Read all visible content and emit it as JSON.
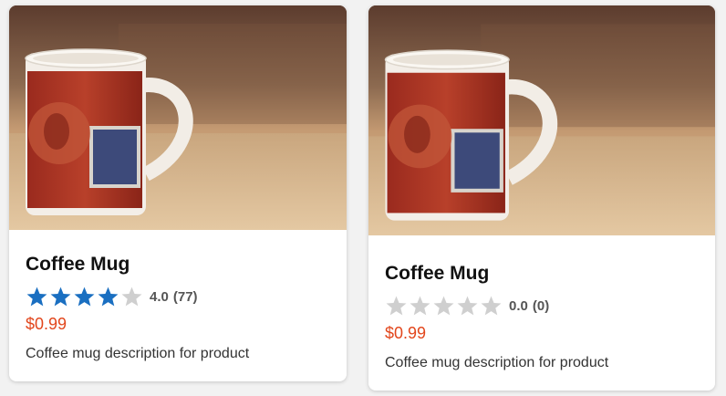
{
  "colors": {
    "star_filled": "#1a6fc1",
    "star_empty": "#cfcfcf",
    "price": "#e2461c"
  },
  "products": [
    {
      "image_icon": "coffee-mug-photo",
      "name": "Coffee Mug",
      "rating": 4.0,
      "rating_label": "4.0",
      "review_count_label": "(77)",
      "price": "$0.99",
      "description": "Coffee mug description for product"
    },
    {
      "image_icon": "coffee-mug-photo",
      "name": "Coffee Mug",
      "rating": 0.0,
      "rating_label": "0.0",
      "review_count_label": "(0)",
      "price": "$0.99",
      "description": "Coffee mug description for product"
    }
  ]
}
